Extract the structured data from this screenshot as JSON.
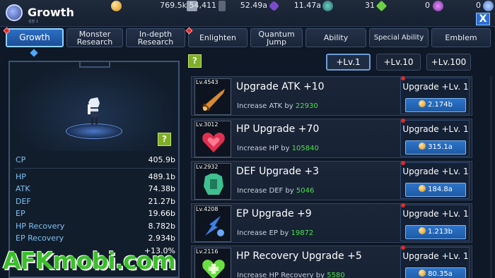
{
  "header": {
    "title": "Growth",
    "subtitle": "성장 1",
    "resources": [
      {
        "icon": "gold-coin-icon",
        "value": "769.5k",
        "color": "#e0a030"
      },
      {
        "icon": "scroll-icon",
        "value": "54,411",
        "color": "#9aa4b2"
      },
      {
        "icon": "dark-crystal-icon",
        "value": "52.49a",
        "color": "#7a4ac8"
      },
      {
        "icon": "gear-ore-icon",
        "value": "11.47a",
        "color": "#6ad0c0"
      },
      {
        "icon": "green-gem-icon",
        "value": "31",
        "color": "#6ad040"
      },
      {
        "icon": "purple-orb-icon",
        "value": "0",
        "color": "#c060e0"
      },
      {
        "icon": "blue-flower-icon",
        "value": "0",
        "color": "#6aa0e0"
      }
    ],
    "close_label": "X"
  },
  "tabs": [
    {
      "label": "Growth",
      "active": true,
      "dot": true
    },
    {
      "label": "Monster Research",
      "active": false,
      "dot": false
    },
    {
      "label": "In-depth Research",
      "active": false,
      "dot": false
    },
    {
      "label": "Enlighten",
      "active": false,
      "dot": true
    },
    {
      "label": "Quantum Jump",
      "active": false,
      "dot": false
    },
    {
      "label": "Ability",
      "active": false,
      "dot": false
    },
    {
      "label": "Special Ability",
      "active": false,
      "dot": false
    },
    {
      "label": "Emblem",
      "active": false,
      "dot": false
    }
  ],
  "level_buttons": [
    {
      "label": "+Lv.1",
      "active": true
    },
    {
      "label": "+Lv.10",
      "active": false
    },
    {
      "label": "+Lv.100",
      "active": false
    }
  ],
  "help_label": "?",
  "stats": {
    "cp": {
      "label": "CP",
      "value": "405.9b"
    },
    "rows": [
      {
        "label": "HP",
        "value": "489.1b"
      },
      {
        "label": "ATK",
        "value": "74.38b"
      },
      {
        "label": "DEF",
        "value": "21.27b"
      },
      {
        "label": "EP",
        "value": "19.66b"
      },
      {
        "label": "HP Recovery",
        "value": "8.782b"
      },
      {
        "label": "EP Recovery",
        "value": "2.934b"
      },
      {
        "label": "",
        "value": "+13.0%"
      },
      {
        "label": "",
        "value": "633%"
      }
    ]
  },
  "upgrades": [
    {
      "level": "Lv.4543",
      "name": "Upgrade ATK +10",
      "desc_prefix": "Increase ATK by",
      "amount": "22930",
      "button": "Upgrade +Lv. 1",
      "cost": "2.174b",
      "icon": "sword-icon",
      "color": "#d88a30"
    },
    {
      "level": "Lv.3012",
      "name": "HP Upgrade +70",
      "desc_prefix": "Increase HP by",
      "amount": "105840",
      "button": "Upgrade +Lv. 1",
      "cost": "315.1a",
      "icon": "heart-icon",
      "color": "#e03050"
    },
    {
      "level": "Lv.2932",
      "name": "DEF Upgrade +3",
      "desc_prefix": "Increase DEF by",
      "amount": "5046",
      "button": "Upgrade +Lv. 1",
      "cost": "184.8a",
      "icon": "armor-icon",
      "color": "#3fc090"
    },
    {
      "level": "Lv.4208",
      "name": "EP Upgrade +9",
      "desc_prefix": "Increase EP by",
      "amount": "19872",
      "button": "Upgrade +Lv. 1",
      "cost": "1.213b",
      "icon": "energy-icon",
      "color": "#3f80e0"
    },
    {
      "level": "Lv.2116",
      "name": "HP Recovery Upgrade +5",
      "desc_prefix": "Increase HP Recovery by",
      "amount": "5580",
      "button": "Upgrade +Lv. 1",
      "cost": "80.35a",
      "icon": "heart-plus-icon",
      "color": "#6ae040"
    }
  ],
  "watermark": "AFKmobi.com"
}
